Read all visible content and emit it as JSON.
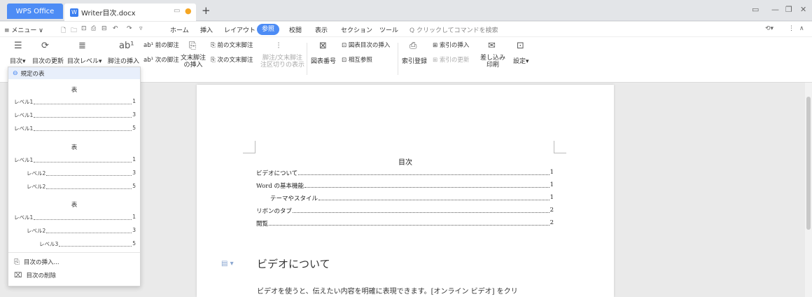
{
  "titlebar": {
    "app_tab": "WPS Office",
    "doc_tab": "Writer目次.docx",
    "doc_icon": "W"
  },
  "menu": {
    "menu_label": "≡ メニュー ∨",
    "tabs": [
      "ホーム",
      "挿入",
      "レイアウト",
      "参照",
      "校閲",
      "表示",
      "セクション",
      "ツール"
    ],
    "active_tab": "参照",
    "search": "Q クリックしてコマンドを検索"
  },
  "ribbon": {
    "toc": "目次",
    "toc_update": "目次の更新",
    "toc_level": "目次レベル",
    "footnote_insert": "脚注の挿入",
    "prev_footnote": "前の脚注",
    "next_footnote": "次の脚注",
    "endnote_insert_1": "文末脚注",
    "endnote_insert_2": "の挿入",
    "prev_endnote": "前の文末脚注",
    "next_endnote": "次の文末脚注",
    "footnote_sep_1": "脚注/文末脚注",
    "footnote_sep_2": "注区切りの表示",
    "caption": "図表番号",
    "figure_toc": "図表目次の挿入",
    "cross_ref": "相互参照",
    "index_entry": "索引登録",
    "index_insert": "索引の挿入",
    "index_update": "索引の更新",
    "mail_merge_1": "差し込み",
    "mail_merge_2": "印刷",
    "settings": "設定"
  },
  "dropdown": {
    "header": "規定の表",
    "sections": [
      {
        "label": "表",
        "rows": [
          {
            "text": "レベル1",
            "page": "1",
            "indent": 0
          },
          {
            "text": "レベル1",
            "page": "3",
            "indent": 0
          },
          {
            "text": "レベル1",
            "page": "5",
            "indent": 0
          }
        ]
      },
      {
        "label": "表",
        "rows": [
          {
            "text": "レベル1",
            "page": "1",
            "indent": 0
          },
          {
            "text": "レベル2",
            "page": "3",
            "indent": 1
          },
          {
            "text": "レベル2",
            "page": "5",
            "indent": 1
          }
        ]
      },
      {
        "label": "表",
        "rows": [
          {
            "text": "レベル1",
            "page": "1",
            "indent": 0
          },
          {
            "text": "レベル2",
            "page": "3",
            "indent": 1
          },
          {
            "text": "レベル3",
            "page": "5",
            "indent": 2
          }
        ]
      }
    ],
    "insert_toc": "目次の挿入...",
    "delete_toc": "目次の削除"
  },
  "document": {
    "toc_title": "目次",
    "toc_entries": [
      {
        "text": "ビデオについて",
        "page": "1",
        "indent": 0
      },
      {
        "text": "Word の基本機能",
        "page": "1",
        "indent": 0
      },
      {
        "text": "テーマやスタイル",
        "page": "1",
        "indent": 1
      },
      {
        "text": "リボンのタブ",
        "page": "2",
        "indent": 0
      },
      {
        "text": "閲覧",
        "page": "2",
        "indent": 0
      }
    ],
    "heading": "ビデオについて",
    "paragraph": "ビデオを使うと、伝えたい内容を明確に表現できます。[オンライン ビデオ] をクリ"
  }
}
